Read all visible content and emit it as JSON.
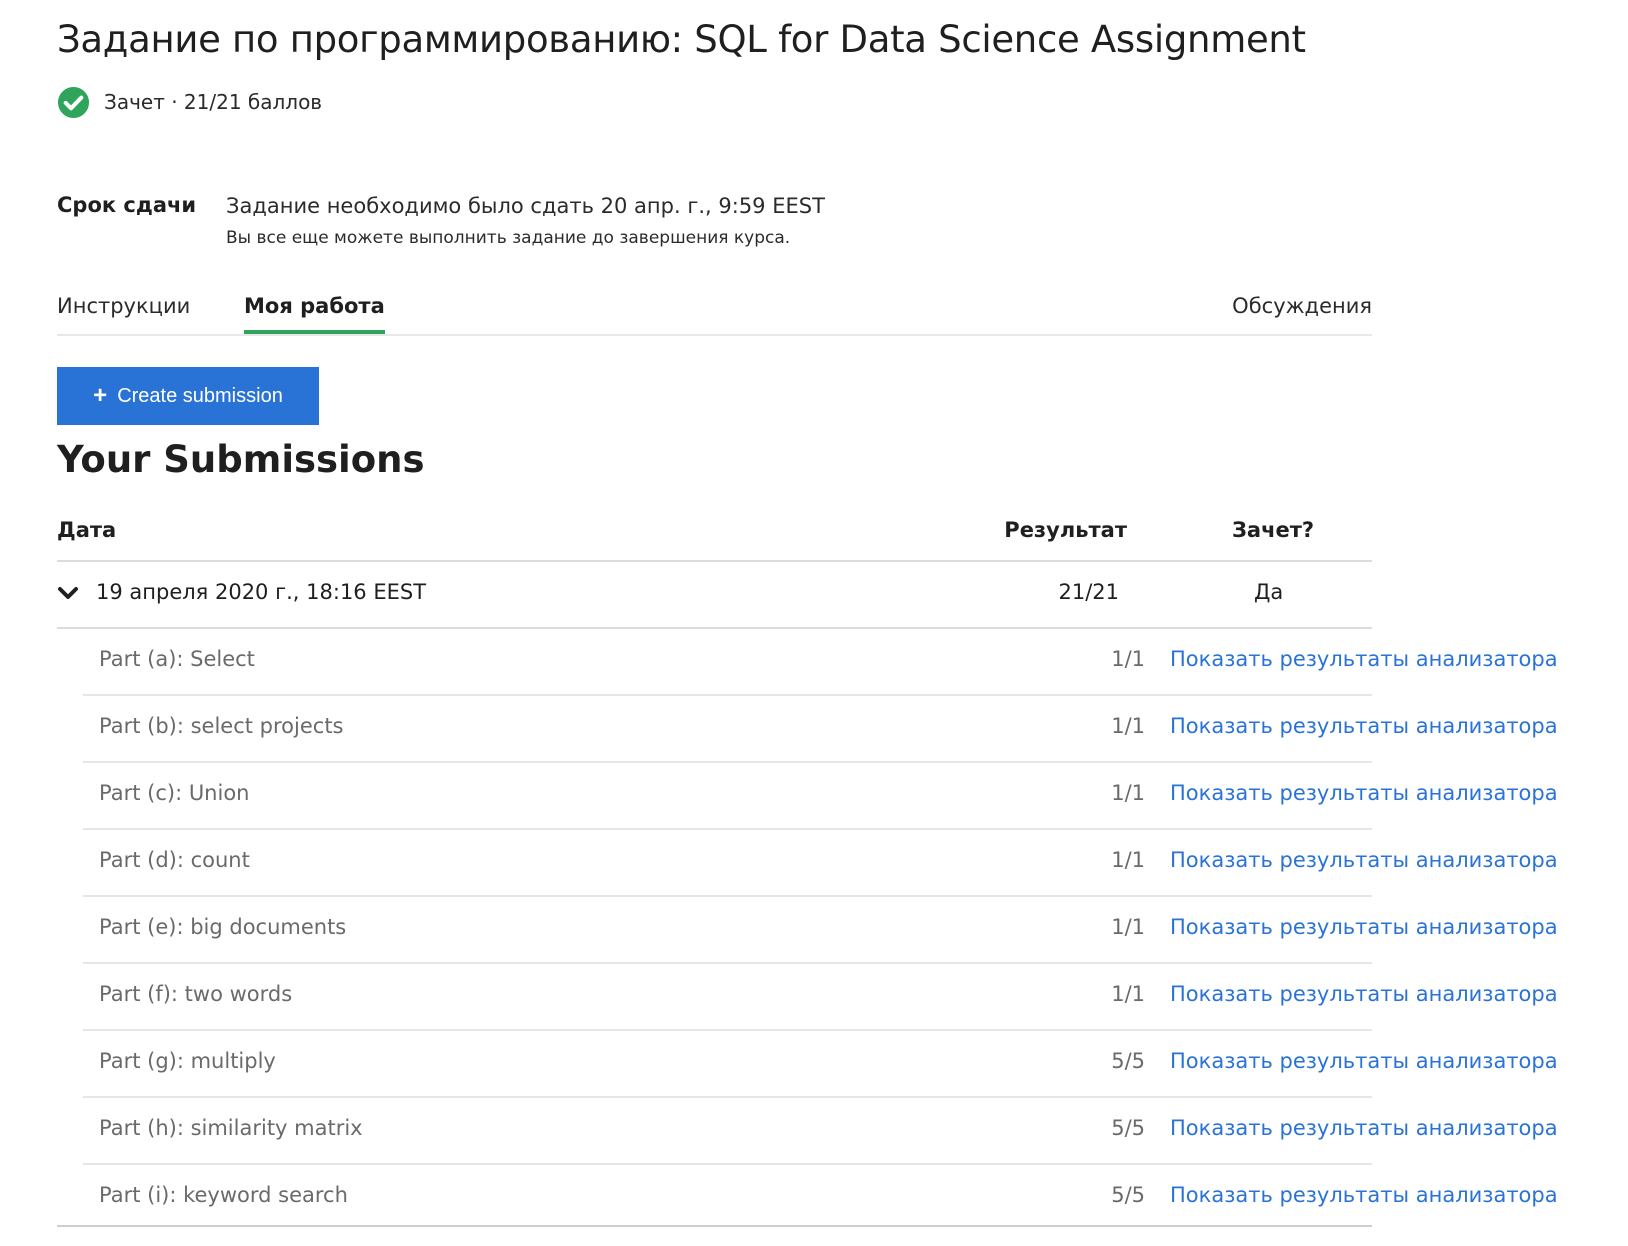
{
  "header": {
    "title": "Задание по программированию: SQL for Data Science Assignment",
    "status": "Зачет · 21/21 баллов"
  },
  "deadline": {
    "label": "Срок сдачи",
    "main": "Задание необходимо было сдать 20 апр. г., 9:59 EEST",
    "sub": "Вы все еще можете выполнить задание до завершения курса."
  },
  "tabs": [
    {
      "label": "Инструкции",
      "active": false
    },
    {
      "label": "Моя работа",
      "active": true
    },
    {
      "label": "Обсуждения",
      "active": false
    }
  ],
  "create_button": {
    "label": "Create submission",
    "icon": "plus-icon"
  },
  "submissions": {
    "heading": "Your Submissions",
    "columns": {
      "date": "Дата",
      "result": "Результат",
      "passed": "Зачет?"
    },
    "rows": [
      {
        "date": "19 апреля 2020 г., 18:16 EEST",
        "result": "21/21",
        "passed": "Да",
        "expanded": true
      }
    ],
    "parts": [
      {
        "name": "Part (a): Select",
        "score": "1/1",
        "link": "Показать результаты анализатора"
      },
      {
        "name": "Part (b): select projects",
        "score": "1/1",
        "link": "Показать результаты анализатора"
      },
      {
        "name": "Part (c): Union",
        "score": "1/1",
        "link": "Показать результаты анализатора"
      },
      {
        "name": "Part (d): count",
        "score": "1/1",
        "link": "Показать результаты анализатора"
      },
      {
        "name": "Part (e): big documents",
        "score": "1/1",
        "link": "Показать результаты анализатора"
      },
      {
        "name": "Part (f): two words",
        "score": "1/1",
        "link": "Показать результаты анализатора"
      },
      {
        "name": "Part (g): multiply",
        "score": "5/5",
        "link": "Показать результаты анализатора"
      },
      {
        "name": "Part (h): similarity matrix",
        "score": "5/5",
        "link": "Показать результаты анализатора"
      },
      {
        "name": "Part (i): keyword search",
        "score": "5/5",
        "link": "Показать результаты анализатора"
      }
    ]
  },
  "colors": {
    "accent": "#2a73d6",
    "success": "#2ea55a",
    "link": "#2a73d6"
  }
}
